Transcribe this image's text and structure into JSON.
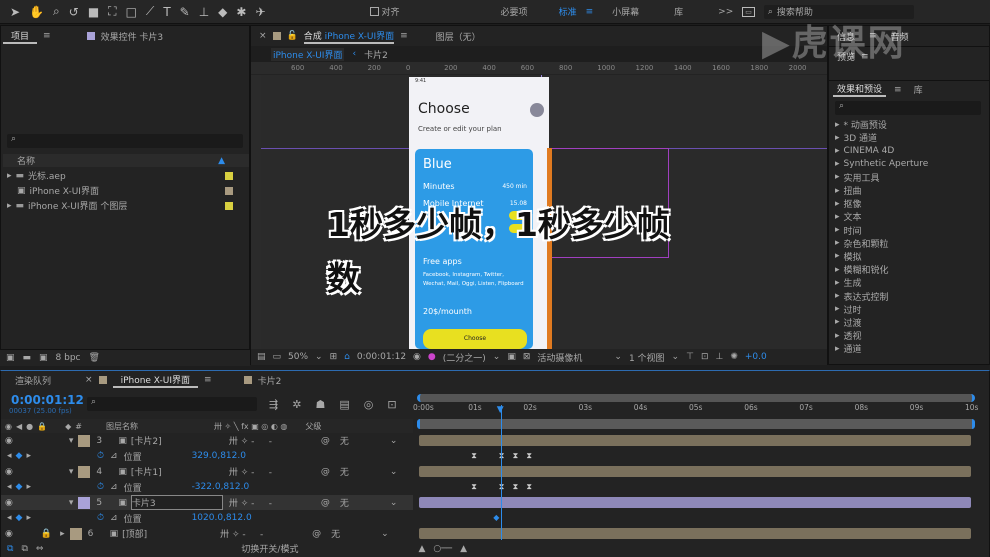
{
  "toolbar": {
    "tools": [
      "selection-tool",
      "hand-tool",
      "zoom-tool",
      "rotate-tool",
      "camera-tool",
      "pan-behind-tool",
      "rectangle-tool",
      "pen-tool",
      "text-tool",
      "brush-tool",
      "clone-stamp-tool",
      "eraser-tool",
      "roto-brush-tool",
      "puppet-tool"
    ],
    "snap_label": "对齐",
    "workspaces": [
      "必要项",
      "标准",
      "小屏幕",
      "库"
    ],
    "active_workspace": "标准",
    "more": ">>",
    "search_placeholder": "搜索帮助"
  },
  "project": {
    "tab_project": "项目",
    "tab_effects_controls": "效果控件 卡片3",
    "column_name": "名称",
    "items": [
      {
        "name": "光标.aep",
        "color": "#d8d040",
        "type": "folder"
      },
      {
        "name": "iPhone X-UI界面",
        "color": "#a89a80",
        "type": "comp"
      },
      {
        "name": "iPhone X-UI界面 个图层",
        "color": "#d8d040",
        "type": "folder"
      }
    ],
    "bpc": "8 bpc"
  },
  "viewer": {
    "tab_comp_prefix": "合成",
    "tab_comp_name": "iPhone X-UI界面",
    "tab_layer": "图层（无）",
    "breadcrumb": [
      "iPhone X-UI界面",
      "卡片2"
    ],
    "ruler_ticks": [
      "600",
      "400",
      "200",
      "0",
      "200",
      "400",
      "600",
      "800",
      "1000",
      "1200",
      "1400",
      "1600",
      "1800",
      "2000"
    ],
    "zoom": "50%",
    "timecode": "0:00:01:12",
    "resolution": "(二分之一)",
    "camera": "活动摄像机",
    "views": "1 个视图",
    "exposure": "+0.0"
  },
  "phone": {
    "time": "9:41",
    "title": "Choose",
    "subtitle": "Create or edit your plan",
    "plan": "Blue",
    "minutes_label": "Minutes",
    "minutes_value": "450 min",
    "internet_label": "Mobile Internet",
    "internet_value": "15.08",
    "free_apps": "Free apps",
    "apps": "Facebook, Instagram, Twitter, Wechat, Mail, Oggi, Listen, Flipboard",
    "price": "20$/mounth",
    "button": "Choose",
    "card_color": "#2d9be6",
    "button_color": "#e8e020"
  },
  "overlay_text": "1秒多少帧，1秒多少帧数",
  "right": {
    "tab_info": "信息",
    "tab_audio": "音频",
    "tab_preview": "预览",
    "tab_effects": "效果和预设",
    "tab_library": "库",
    "effects": [
      "* 动画预设",
      "3D 通道",
      "CINEMA 4D",
      "Synthetic Aperture",
      "实用工具",
      "扭曲",
      "抠像",
      "文本",
      "时间",
      "杂色和颗粒",
      "模拟",
      "模糊和锐化",
      "生成",
      "表达式控制",
      "过时",
      "过渡",
      "透视",
      "通道"
    ]
  },
  "watermark": "虎课网",
  "timeline": {
    "tab_render": "渲染队列",
    "tab_comp": "iPhone X-UI界面",
    "tab_card2": "卡片2",
    "timecode": "0:00:01:12",
    "frame_info": "00037 (25.00 fps)",
    "col_layer_name": "图层名称",
    "col_parent": "父级",
    "toggle_label": "切换开关/模式",
    "time_ticks": [
      "0:00s",
      "01s",
      "02s",
      "03s",
      "04s",
      "05s",
      "06s",
      "07s",
      "08s",
      "09s",
      "10s"
    ],
    "playhead_seconds": 1.48,
    "rows": [
      {
        "kind": "layer",
        "num": "3",
        "name": "[卡片2]",
        "color": "#a89a80",
        "parent": "无"
      },
      {
        "kind": "prop",
        "name": "位置",
        "value": "329.0,812.0",
        "keyframes": [
          1.0,
          1.5,
          1.75,
          2.0
        ]
      },
      {
        "kind": "layer",
        "num": "4",
        "name": "[卡片1]",
        "color": "#a89a80",
        "parent": "无"
      },
      {
        "kind": "prop",
        "name": "位置",
        "value": "-322.0,812.0",
        "keyframes": [
          1.0,
          1.5,
          1.75,
          2.0
        ]
      },
      {
        "kind": "layer",
        "num": "5",
        "name": "卡片3",
        "color": "#a9a2d8",
        "parent": "无",
        "selected": true
      },
      {
        "kind": "prop",
        "name": "位置",
        "value": "1020.0,812.0",
        "keyframes": [
          1.4
        ]
      },
      {
        "kind": "layer",
        "num": "6",
        "name": "[顶部]",
        "color": "#a89a80",
        "parent": "无",
        "locked": true
      }
    ]
  }
}
